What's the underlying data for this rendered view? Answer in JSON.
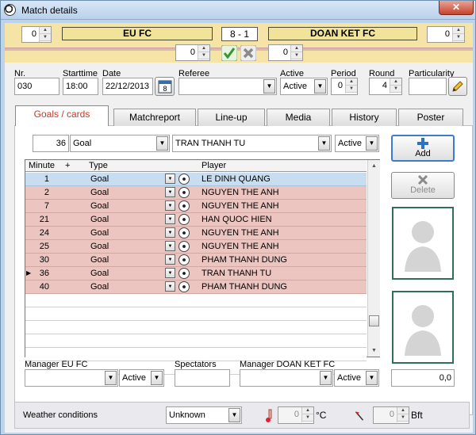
{
  "window": {
    "title": "Match details",
    "close_glyph": "✕"
  },
  "header": {
    "left_spin": "0",
    "home_team": "EU FC",
    "score": "8  - 1",
    "away_team": "DOAN KET FC",
    "right_spin": "0",
    "home_extra": "0",
    "away_extra": "0"
  },
  "info": {
    "nr_label": "Nr.",
    "nr_value": "030",
    "starttime_label": "Starttime",
    "starttime_value": "18:00",
    "date_label": "Date",
    "date_value": "22/12/2013",
    "calendar_day": "8",
    "referee_label": "Referee",
    "referee_value": "",
    "active_label": "Active",
    "active_value": "Active",
    "period_label": "Period",
    "period_value": "0",
    "round_label": "Round",
    "round_value": "4",
    "particularity_label": "Particularity",
    "particularity_value": ""
  },
  "tabs": [
    {
      "label": "Goals / cards",
      "active": true
    },
    {
      "label": "Matchreport",
      "active": false
    },
    {
      "label": "Line-up",
      "active": false
    },
    {
      "label": "Media",
      "active": false
    },
    {
      "label": "History",
      "active": false
    },
    {
      "label": "Poster",
      "active": false
    }
  ],
  "entry": {
    "minute": "36",
    "type": "Goal",
    "player": "TRAN THANH TU",
    "status": "Active"
  },
  "grid": {
    "columns": [
      "Minute",
      "+",
      "Type",
      "Player"
    ],
    "rows": [
      {
        "minute": "1",
        "type": "Goal",
        "player": "LE DINH QUANG",
        "selected": true,
        "current": false
      },
      {
        "minute": "2",
        "type": "Goal",
        "player": "NGUYEN THE ANH",
        "selected": false,
        "current": false
      },
      {
        "minute": "7",
        "type": "Goal",
        "player": "NGUYEN THE ANH",
        "selected": false,
        "current": false
      },
      {
        "minute": "21",
        "type": "Goal",
        "player": "HAN QUOC HIEN",
        "selected": false,
        "current": false
      },
      {
        "minute": "24",
        "type": "Goal",
        "player": "NGUYEN THE ANH",
        "selected": false,
        "current": false
      },
      {
        "minute": "25",
        "type": "Goal",
        "player": "NGUYEN THE ANH",
        "selected": false,
        "current": false
      },
      {
        "minute": "30",
        "type": "Goal",
        "player": "PHAM THANH DUNG",
        "selected": false,
        "current": false
      },
      {
        "minute": "36",
        "type": "Goal",
        "player": "TRAN THANH TU",
        "selected": false,
        "current": true
      },
      {
        "minute": "40",
        "type": "Goal",
        "player": "PHAM THANH DUNG",
        "selected": false,
        "current": false
      }
    ],
    "empty_rows": 6
  },
  "buttons": {
    "add": "Add",
    "delete": "Delete"
  },
  "managers": {
    "home_label": "Manager EU FC",
    "home_status": "Active",
    "spectators_label": "Spectators",
    "spectators_value": "",
    "away_label": "Manager DOAN KET FC",
    "away_status": "Active",
    "amount": "0,0"
  },
  "weather": {
    "label": "Weather conditions",
    "condition": "Unknown",
    "temperature": "0",
    "temp_unit": "°C",
    "wind": "0",
    "wind_unit": "Bft"
  },
  "colors": {
    "title_gradient": "#bcd3ea",
    "header_band": "#f5e4a6",
    "row_goal": "#ecc5c0",
    "row_selected": "#c9ddf0",
    "active_tab_text": "#c0392b"
  }
}
